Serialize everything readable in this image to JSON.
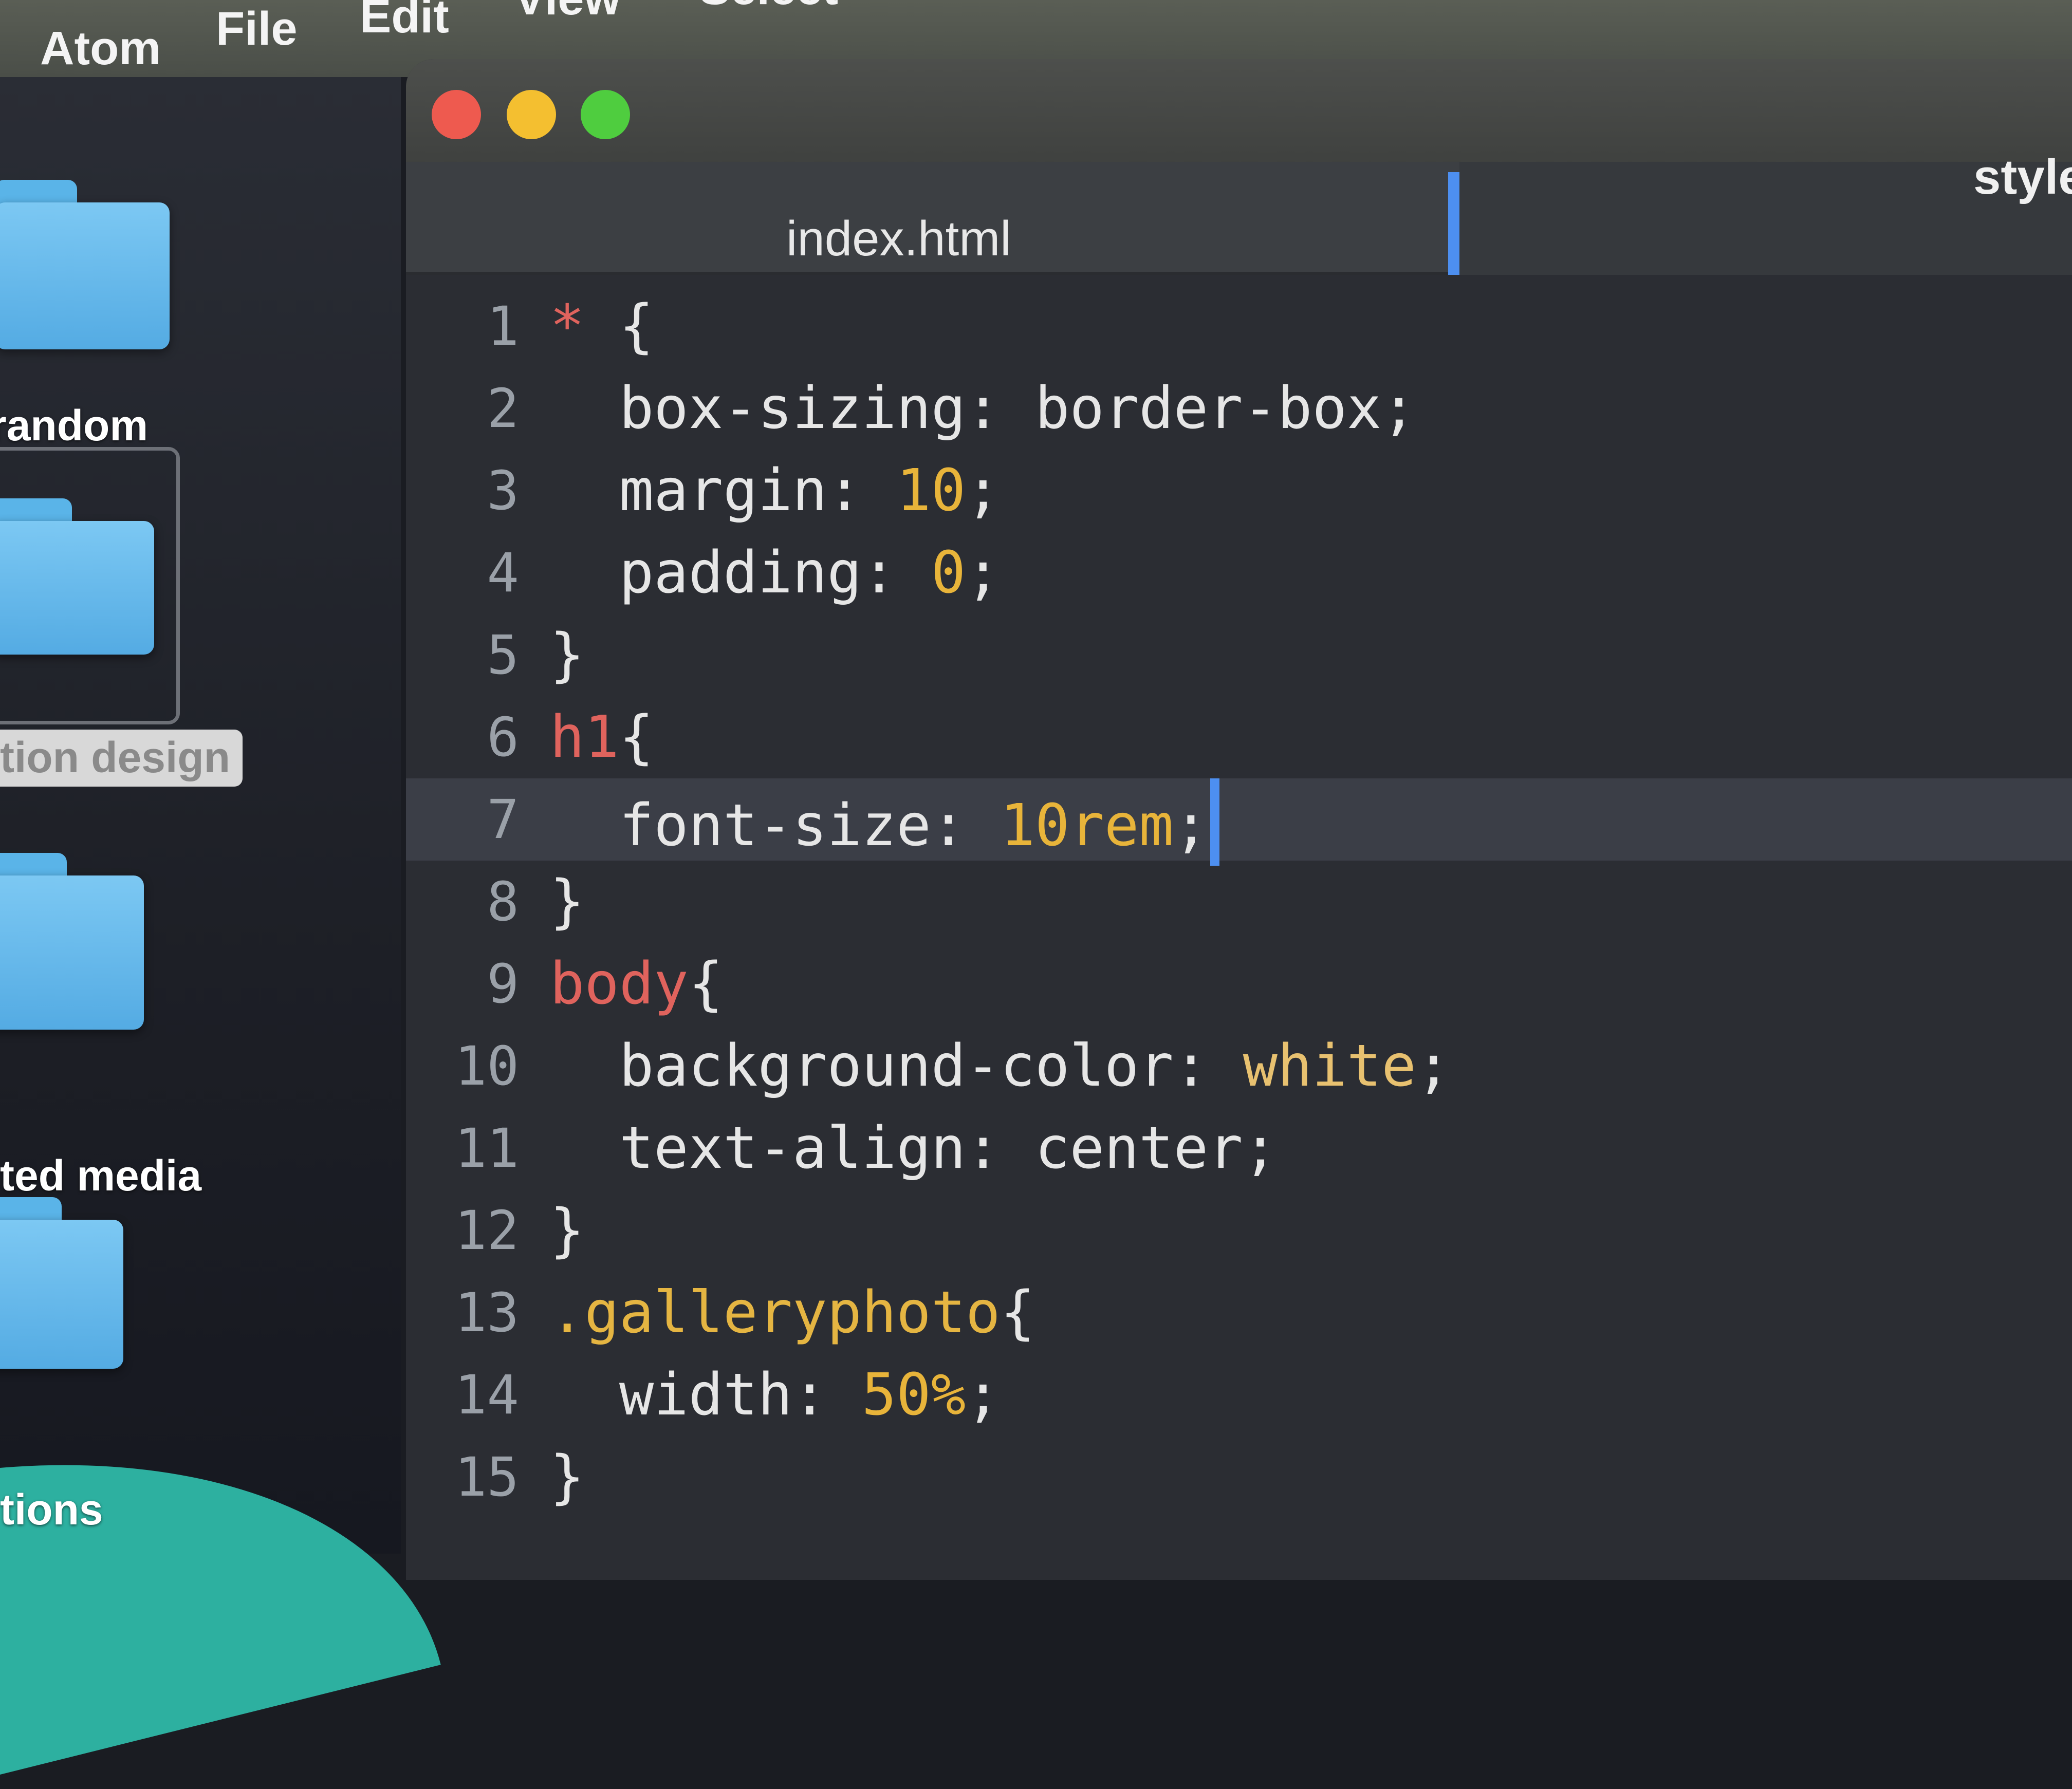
{
  "menubar": {
    "app": "Atom",
    "items": [
      "File",
      "Edit",
      "View",
      "Select"
    ]
  },
  "desktop": {
    "folders": [
      {
        "label": "random"
      },
      {
        "label": "tion design",
        "selected": true
      },
      {
        "label": "ted media"
      },
      {
        "label": "tions"
      }
    ]
  },
  "window": {
    "tabs": [
      {
        "title": "index.html",
        "active": true
      },
      {
        "title": "styles",
        "active": false
      }
    ],
    "traffic_lights": [
      "close",
      "minimize",
      "maximize"
    ]
  },
  "editor": {
    "cursor_line": 7,
    "lines": [
      {
        "n": "1",
        "tokens": [
          {
            "t": "* ",
            "c": "sel"
          },
          {
            "t": "{",
            "c": "punct"
          }
        ]
      },
      {
        "n": "2",
        "tokens": [
          {
            "t": "  box-sizing",
            "c": "prop"
          },
          {
            "t": ": ",
            "c": "punct"
          },
          {
            "t": "border-box",
            "c": "val"
          },
          {
            "t": ";",
            "c": "punct"
          }
        ]
      },
      {
        "n": "3",
        "tokens": [
          {
            "t": "  margin",
            "c": "prop"
          },
          {
            "t": ": ",
            "c": "punct"
          },
          {
            "t": "10",
            "c": "num"
          },
          {
            "t": ";",
            "c": "punct"
          }
        ]
      },
      {
        "n": "4",
        "tokens": [
          {
            "t": "  padding",
            "c": "prop"
          },
          {
            "t": ": ",
            "c": "punct"
          },
          {
            "t": "0",
            "c": "num"
          },
          {
            "t": ";",
            "c": "punct"
          }
        ]
      },
      {
        "n": "5",
        "tokens": [
          {
            "t": "}",
            "c": "punct"
          }
        ]
      },
      {
        "n": "6",
        "tokens": [
          {
            "t": "h1",
            "c": "sel"
          },
          {
            "t": "{",
            "c": "punct"
          }
        ]
      },
      {
        "n": "7",
        "tokens": [
          {
            "t": "  font-size",
            "c": "prop"
          },
          {
            "t": ": ",
            "c": "punct"
          },
          {
            "t": "10rem",
            "c": "num"
          },
          {
            "t": ";",
            "c": "punct"
          }
        ]
      },
      {
        "n": "8",
        "tokens": [
          {
            "t": "}",
            "c": "punct"
          }
        ]
      },
      {
        "n": "9",
        "tokens": [
          {
            "t": "body",
            "c": "sel"
          },
          {
            "t": "{",
            "c": "punct"
          }
        ]
      },
      {
        "n": "10",
        "tokens": [
          {
            "t": "  background-color",
            "c": "prop"
          },
          {
            "t": ": ",
            "c": "punct"
          },
          {
            "t": "white",
            "c": "kw"
          },
          {
            "t": ";",
            "c": "punct"
          }
        ]
      },
      {
        "n": "11",
        "tokens": [
          {
            "t": "  text-align",
            "c": "prop"
          },
          {
            "t": ": ",
            "c": "punct"
          },
          {
            "t": "center",
            "c": "val"
          },
          {
            "t": ";",
            "c": "punct"
          }
        ]
      },
      {
        "n": "12",
        "tokens": [
          {
            "t": "}",
            "c": "punct"
          }
        ]
      },
      {
        "n": "13",
        "tokens": [
          {
            "t": ".galleryphoto",
            "c": "class"
          },
          {
            "t": "{",
            "c": "punct"
          }
        ]
      },
      {
        "n": "14",
        "tokens": [
          {
            "t": "  width",
            "c": "prop"
          },
          {
            "t": ": ",
            "c": "punct"
          },
          {
            "t": "50%",
            "c": "num"
          },
          {
            "t": ";",
            "c": "punct"
          }
        ]
      },
      {
        "n": "15",
        "tokens": [
          {
            "t": "}",
            "c": "punct"
          }
        ]
      }
    ]
  },
  "colors": {
    "selector": "#e0635d",
    "number": "#e8b43a",
    "keyword": "#e8c170",
    "class": "#e5b542",
    "caret": "#4d8ff0",
    "editor_bg": "#2b2d33"
  }
}
